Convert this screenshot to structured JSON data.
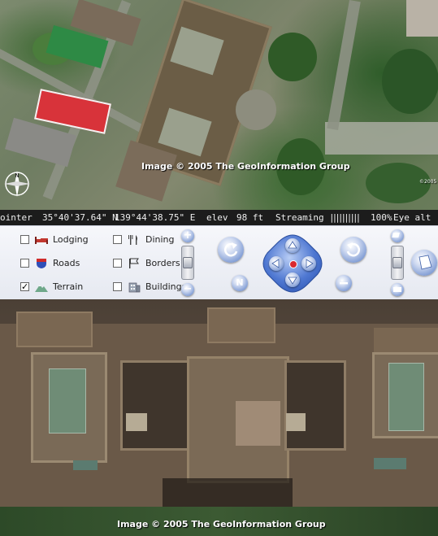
{
  "top_view": {
    "copyright": "Image © 2005 The GeoInformation Group",
    "small_copyright": "©2005"
  },
  "status_bar": {
    "pointer_label": "ointer",
    "latitude": "35°40'37.64\" N",
    "longitude": "139°44'38.75\" E",
    "elev_label": "elev",
    "elev_value": "98 ft",
    "streaming_label": "Streaming",
    "streaming_bar": "||||||||||",
    "streaming_percent": "100%",
    "eye_alt_label": "Eye  alt"
  },
  "layers": [
    {
      "label": "Lodging",
      "checked": false,
      "icon": "bed-icon"
    },
    {
      "label": "Dining",
      "checked": false,
      "icon": "fork-knife-icon"
    },
    {
      "label": "Roads",
      "checked": false,
      "icon": "road-shield-icon"
    },
    {
      "label": "Borders",
      "checked": false,
      "icon": "flag-icon"
    },
    {
      "label": "Terrain",
      "checked": true,
      "icon": "mountain-icon"
    },
    {
      "label": "Buildings",
      "checked": false,
      "icon": "building-icon"
    }
  ],
  "controls": {
    "compass_north": "N",
    "zoom_in_glyph": "+",
    "zoom_out_glyph": "−"
  },
  "bottom_view": {
    "copyright": "Image © 2005 The GeoInformation Group"
  },
  "colors": {
    "control_panel_bg": "#eef0f6",
    "button_blue": "#4a6bb0",
    "status_bar_bg": "#1c1c1c"
  }
}
